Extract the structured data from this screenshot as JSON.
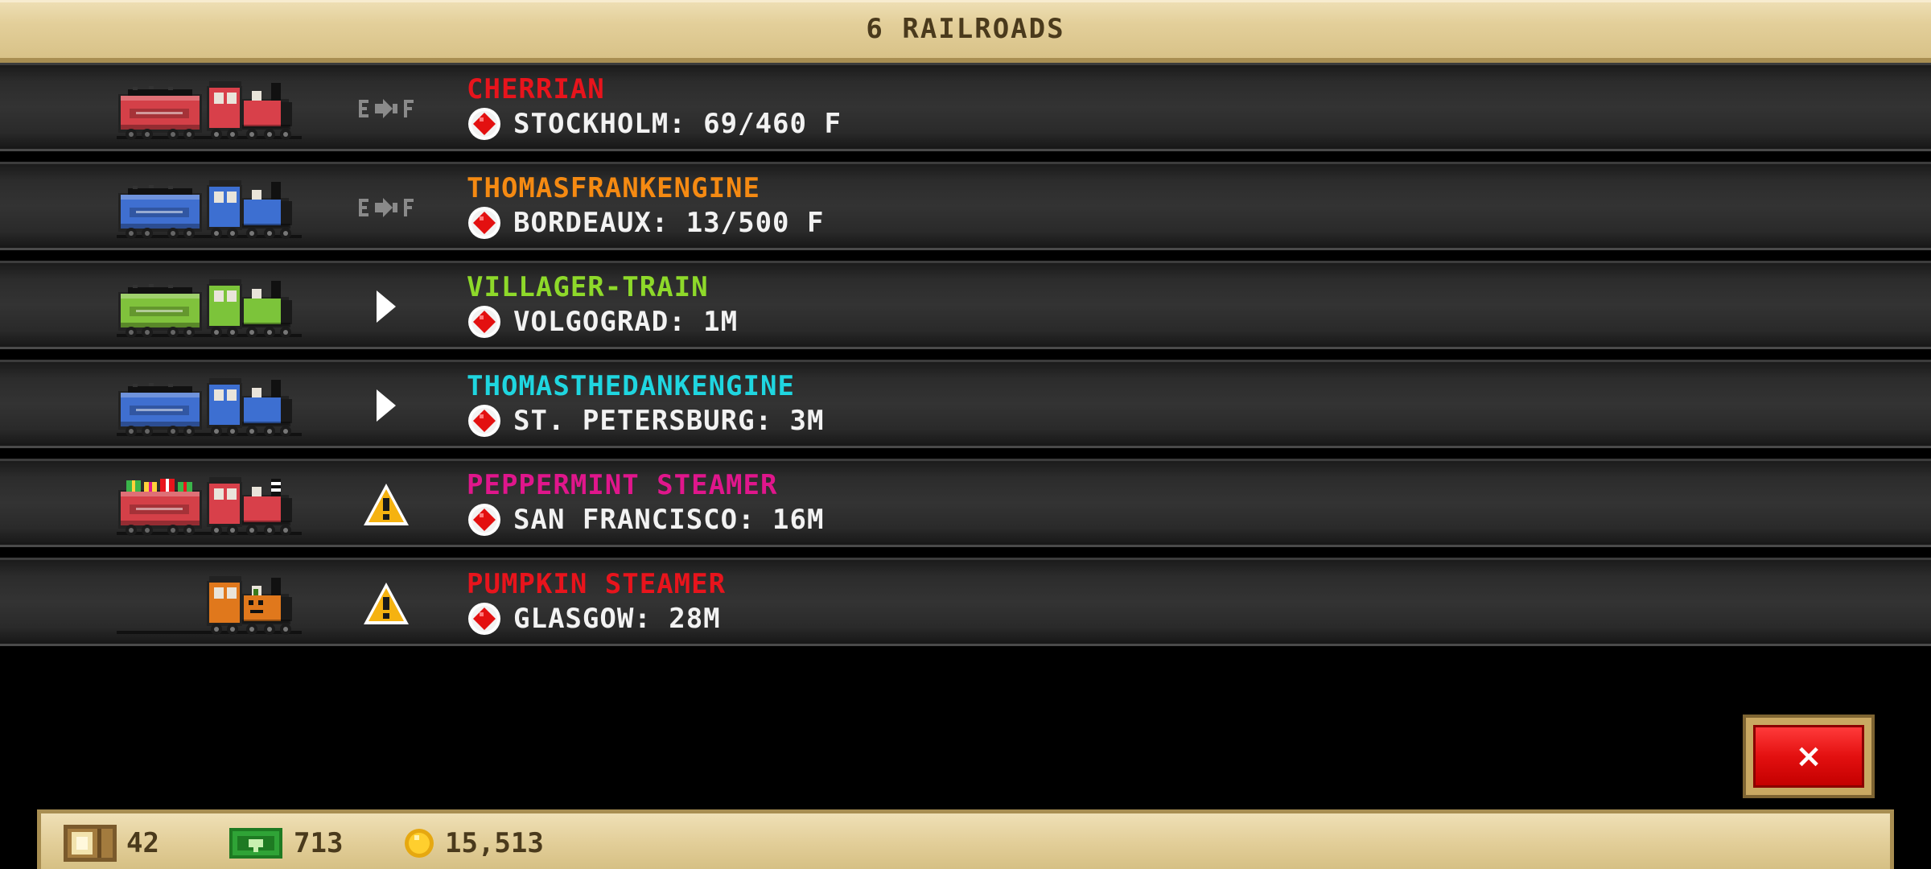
{
  "header": {
    "title": "6 RAILROADS"
  },
  "railroads": [
    {
      "name": "CHERRIAN",
      "name_color": "#e8141c",
      "destination": "STOCKHOLM: 69/460 F",
      "status": "transfer",
      "train": {
        "engine_color": "#d8404a",
        "car_color": "#d44048",
        "has_car": true,
        "theme": "standard"
      }
    },
    {
      "name": "THOMASFRANKENGINE",
      "name_color": "#f58a12",
      "destination": "BORDEAUX: 13/500 F",
      "status": "transfer",
      "train": {
        "engine_color": "#3d6fd1",
        "car_color": "#3f6fd0",
        "has_car": true,
        "theme": "standard"
      }
    },
    {
      "name": "VILLAGER-TRAIN",
      "name_color": "#8ed92a",
      "destination": "VOLGOGRAD: 1M",
      "status": "play",
      "train": {
        "engine_color": "#7cc43a",
        "car_color": "#80c23c",
        "has_car": true,
        "theme": "standard"
      }
    },
    {
      "name": "THOMASTHEDANKENGINE",
      "name_color": "#1fd6e0",
      "destination": "ST. PETERSBURG: 3M",
      "status": "play",
      "train": {
        "engine_color": "#3d6fd1",
        "car_color": "#3f6fd0",
        "has_car": true,
        "theme": "standard"
      }
    },
    {
      "name": "PEPPERMINT STEAMER",
      "name_color": "#e0168c",
      "destination": "SAN FRANCISCO: 16M",
      "status": "warning",
      "train": {
        "engine_color": "#d8404a",
        "car_color": "#d44048",
        "has_car": true,
        "theme": "peppermint"
      }
    },
    {
      "name": "PUMPKIN STEAMER",
      "name_color": "#e8141c",
      "destination": "GLASGOW: 28M",
      "status": "warning",
      "train": {
        "engine_color": "#e0781c",
        "car_color": "#e0781c",
        "has_car": false,
        "theme": "pumpkin"
      }
    }
  ],
  "status_icons": {
    "transfer": "transfer-icon",
    "play": "play-icon",
    "warning": "warning-icon"
  },
  "close_button": {
    "label": "×",
    "color": "#e31010"
  },
  "footer": {
    "crates": "42",
    "cash": "713",
    "coins": "15,513"
  }
}
